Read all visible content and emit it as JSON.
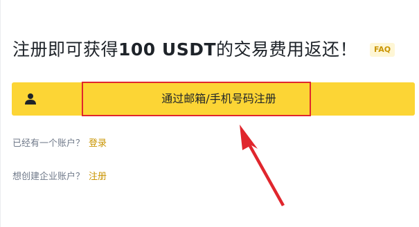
{
  "header": {
    "title_prefix": "注册即可获得",
    "title_amount": "100 USDT",
    "title_suffix": "的交易费用返还！",
    "faq_label": "FAQ"
  },
  "signup": {
    "button_label": "通过邮箱/手机号码注册",
    "icon": "user-icon",
    "button_color": "#fcd535"
  },
  "links": {
    "login_prompt": "已经有一个账户？",
    "login_link": "登录",
    "business_prompt": "想创建企业账户？",
    "business_link": "注册"
  },
  "annotation": {
    "highlight_color": "#e0262d"
  },
  "colors": {
    "accent_text": "#c99400",
    "secondary_text": "#707a8a",
    "primary_text": "#1e2329"
  }
}
